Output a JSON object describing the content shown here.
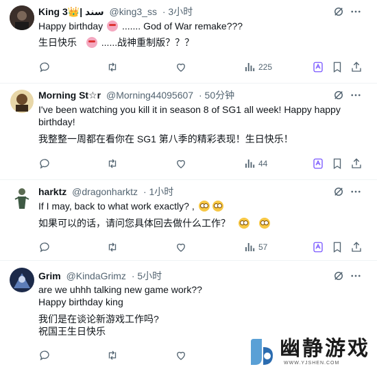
{
  "tweets": [
    {
      "name": "King 3👑| سند",
      "handle": "@king3_ss",
      "time": "· 3小时",
      "lines": [
        "Happy birthday",
        "....... God of War remake???",
        "生日快乐",
        "......战神重制版？？？"
      ],
      "views": "225"
    },
    {
      "name": "Morning St☆r",
      "handle": "@Morning44095607",
      "time": "· 50分钟",
      "lines": [
        "I've been watching you kill it in season 8 of SG1 all week! Happy happy",
        "birthday!",
        "我整整一周都在看你在 SG1 第八季的精彩表现！生日快乐！"
      ],
      "views": "44"
    },
    {
      "name": "harktz",
      "handle": "@dragonharktz",
      "time": "· 1小时",
      "lines": [
        "If I may, back to what work exactly? ,",
        "如果可以的话，请问您具体回去做什么工作？"
      ],
      "views": "57"
    },
    {
      "name": "Grim",
      "handle": "@KindaGrimz",
      "time": "· 5小时",
      "lines": [
        "are we uhhh  talking new game work??",
        "Happy birthday king",
        "我们是在谈论新游戏工作吗?",
        "祝国王生日快乐"
      ],
      "views": ""
    }
  ],
  "watermark": {
    "title": "幽静游戏",
    "url": "WWW.YJSHEN.COM"
  },
  "icons": {
    "reply": "reply-icon",
    "retweet": "retweet-icon",
    "like": "heart-icon",
    "views": "views-icon",
    "grok": "grok-icon",
    "bookmark": "bookmark-icon",
    "share": "share-icon",
    "more": "more-icon",
    "translate": "translate-icon"
  },
  "colors": {
    "secondary_text": "#536471",
    "divider": "#eff3f4",
    "grok_accent": "#7856ff"
  }
}
